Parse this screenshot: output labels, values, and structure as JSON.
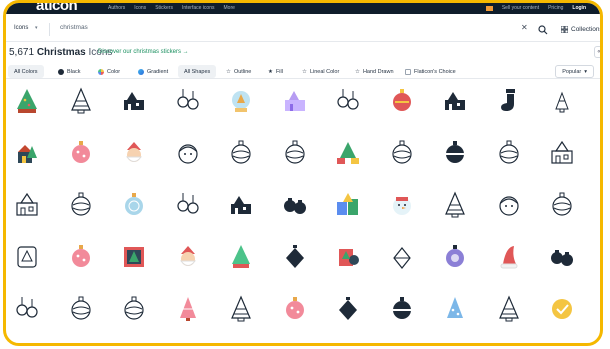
{
  "topbar": {
    "logo": "aticon",
    "nav": [
      "Authors",
      "Icons",
      "Stickers",
      "Interface icons",
      "More"
    ],
    "right": [
      "Sell your content",
      "Pricing",
      "Login"
    ]
  },
  "search": {
    "scope_label": "Icons",
    "query": "christmas",
    "collections_label": "Collections"
  },
  "results": {
    "count": "5,671",
    "term": "Christmas",
    "kind": "Icons",
    "discover_link": "Discover our christmas stickers →"
  },
  "filters": {
    "colors": [
      {
        "label": "All Colors",
        "active": true
      },
      {
        "label": "Black"
      },
      {
        "label": "Color"
      },
      {
        "label": "Gradient"
      }
    ],
    "shapes": [
      {
        "label": "All Shapes",
        "active": true
      },
      {
        "label": "Outline"
      },
      {
        "label": "Fill"
      },
      {
        "label": "Lineal Color"
      },
      {
        "label": "Hand Drawn"
      }
    ],
    "checkbox_label": "Flaticon's Choice",
    "sort_label": "Popular"
  },
  "icon_rows": [
    [
      "tree-color",
      "tree-outline",
      "village-black",
      "ornaments-outline",
      "globe-color",
      "village-gradient",
      "ornaments-outline",
      "ornament-red",
      "village-black",
      "stocking-black",
      "tree-outline-small"
    ],
    [
      "house-color",
      "ball-pink",
      "santa-color",
      "santa-outline",
      "ball-outline",
      "ball-outline",
      "tree-gift-color",
      "ball-outline",
      "ball-black",
      "ball-outline",
      "village-outline"
    ],
    [
      "village-outline",
      "ball-outline",
      "ball-blue",
      "ornaments-outline",
      "village-black",
      "ornaments-black",
      "gifts-color",
      "snowman-color",
      "tree-outline",
      "santa-outline",
      "ball-outline"
    ],
    [
      "tree-card-outline",
      "ball-pink",
      "card-color",
      "santa-color",
      "tree-green",
      "ornament-black",
      "card-red",
      "ornament-outline",
      "ball-purple",
      "hat-red",
      "ornaments-black"
    ],
    [
      "ornaments-outline",
      "ball-outline",
      "ball-outline",
      "tree-pink",
      "tree-outline",
      "ball-pink",
      "ornament-black",
      "ball-black",
      "tree-blue",
      "tree-outline",
      "button-badge"
    ]
  ],
  "colors": {
    "accent": "#f5b800",
    "brand_dark": "#0f1d2b",
    "link_green": "#1a8f5f"
  }
}
